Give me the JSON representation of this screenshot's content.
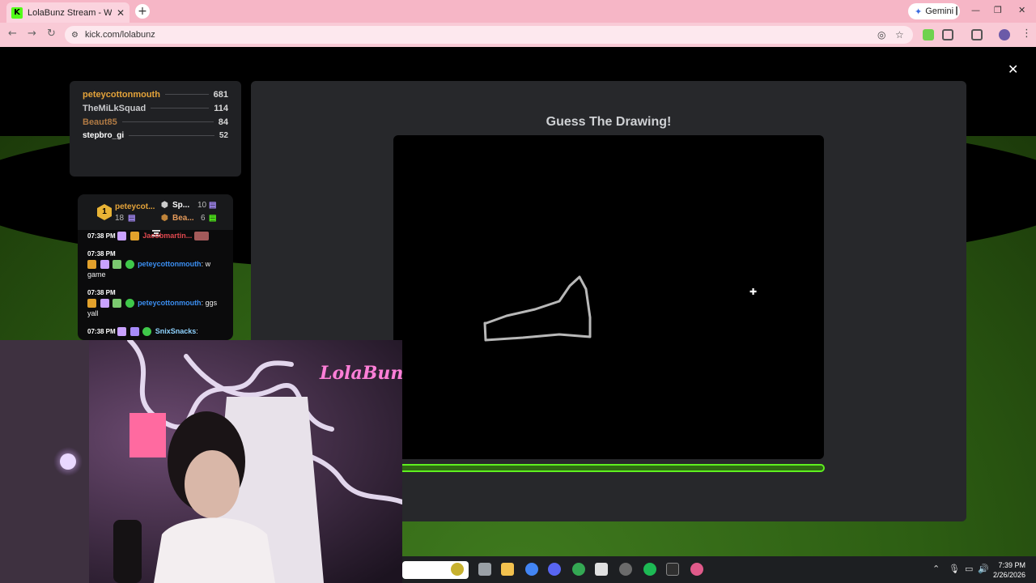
{
  "browser": {
    "tab_title": "LolaBunz Stream - Watch Live o",
    "tab_favicon": "K",
    "tab_close": "✕",
    "new_tab": "+",
    "gemini_label": "Gemini",
    "url": "kick.com/lolabunz",
    "back_icon": "←",
    "forward_icon": "→",
    "reload_icon": "↻"
  },
  "overlay": {
    "close_icon": "✕"
  },
  "leaderboard": [
    {
      "name": "peteycottonmouth",
      "score": "681",
      "color": "#e4a33a"
    },
    {
      "name": "TheMiLkSquad",
      "score": "114",
      "color": "#c8c9cc"
    },
    {
      "name": "Beaut85",
      "score": "84",
      "color": "#b07a44"
    },
    {
      "name": "stepbro_gi",
      "score": "52",
      "color": "#ffffff"
    }
  ],
  "top_gifters": {
    "rank": "1",
    "first_name": "peteycot...",
    "first_count": "18",
    "second_name": "Sp...",
    "second_count": "10",
    "third_name": "Bea...",
    "third_count": "6"
  },
  "chat": {
    "messages": [
      {
        "time": "07:38 PM",
        "user": "Jacobmartin...",
        "text": "",
        "color": "#e0484f"
      },
      {
        "time": "07:38 PM",
        "user": "peteycottonmouth",
        "text": ": w game",
        "color": "#3b8ef0"
      },
      {
        "time": "07:38 PM",
        "user": "peteycottonmouth",
        "text": ": ggs yall",
        "color": "#3b8ef0"
      },
      {
        "time": "07:38 PM",
        "user": "SnixSnacks",
        "text": ":",
        "color": "#8fd3ff"
      }
    ]
  },
  "game": {
    "title": "Guess The Drawing!",
    "crosshair": "✚",
    "timer_fraction": 1.0
  },
  "webcam": {
    "neon_sign": "LolaBunz"
  },
  "taskbar": {
    "time": "7:39 PM",
    "date": "2/26/2026"
  },
  "colors": {
    "kick_green": "#53fc18",
    "chrome_pink": "#f6b6c6"
  }
}
